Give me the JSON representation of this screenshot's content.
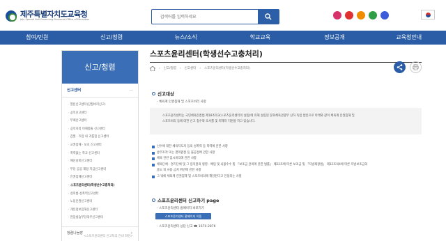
{
  "header": {
    "logo_title": "제주특별자치도교육청",
    "logo_subtitle": "Jeju Special Self-Governing Provincial Office of Education",
    "search_placeholder": "검색어를 입력하세요",
    "sns": [
      {
        "icon": "instagram-icon",
        "color": "#d6336c"
      },
      {
        "icon": "youtube-icon",
        "color": "#e03131"
      },
      {
        "icon": "kakao-icon",
        "color": "#f08c00"
      },
      {
        "icon": "blog-icon",
        "color": "#2f9e44"
      },
      {
        "icon": "facebook-icon",
        "color": "#3b5bdb"
      }
    ],
    "flag_icon": "korean-flag-icon"
  },
  "nav": [
    "참여/민원",
    "신고/청렴",
    "뉴스/소식",
    "학교교육",
    "정보공개",
    "교육청안내"
  ],
  "sidebar": {
    "title": "신고/청렴",
    "group_label": "신고센터",
    "group_toggle": "—",
    "items": [
      "열린신고센터(갑질비리신고)",
      "공익신고센터",
      "부패신고센터",
      "공직자의 이해충돌 신고센터",
      "갑질 · 직장 내 괴롭힘 신고센터",
      "교권침해 · 보호 신고센터",
      "폭력없는 학교 신고센터",
      "예산낭비신고센터",
      "부당 공공 재정 지급신고센터",
      "인권침해신고센터",
      "스포츠윤리센터(학생선수고충처리)",
      "성희롱·성폭력신고센터",
      "노동인권신고센터",
      "개인정보침해신고센터",
      "현장실습부당대우신고센터"
    ],
    "active_index": 10,
    "footer_label": "청렴나눔방",
    "footer_toggle": "+"
  },
  "content": {
    "title": "스포츠윤리센터(학생선수고충처리)",
    "breadcrumb": [
      "신고/청렴",
      "신고센터",
      "스포츠윤리센터(학생선수고충처리)"
    ],
    "section1_title": "신고대상",
    "section1_sub": "체육계 인권침해 및 스포츠비리 사항",
    "box_text_1": "스포츠윤리센터는 국민체육진흥법 제18조의3(스포츠윤리센터의 설립)에 의해 설립된 문화체육관광부 산하 독립 법인으로 아래와 같이 체육계 인권침해 및",
    "box_text_2": "스포츠비리 등에 대한 신고 접수와 조사를 및 피해자 지원을 하고 있습니다.",
    "bullets": [
      "선수에 대한 체육지도자 등의 성폭력 등 폭력에 관한 사항",
      "승부조작 또는 편파판정 등 불공정에 관한 사항",
      "체육 관련 입시비리에 관한 사항",
      "체육단체 · 경기단체 및 그 임직원의 횡령 · 배임 및 뇌물수수 및 「보조금 관리에 관한 법률」 제22조에 따른 보조금 및 「지방재정법」 제32조의4에 따른 지방보조금의",
      "용도 외 사용 금지 위반에 관한 사항",
      "그 밖에 체육계 인권침해 및 스포츠비리에 해당된다고 인정되는 사항"
    ],
    "section2_title": "스포츠윤리센터 신고하기 page",
    "section2_line1": "스포츠윤리센터 홈페이지 바로가기",
    "section2_button": "스포츠윤리센터 홈페이지 이동",
    "section2_line2": "스포츠윤리센터 상담 신고 ☎ 1670-2876"
  },
  "caption": "<스포츠윤리센터 신고처리 안내 화면>"
}
